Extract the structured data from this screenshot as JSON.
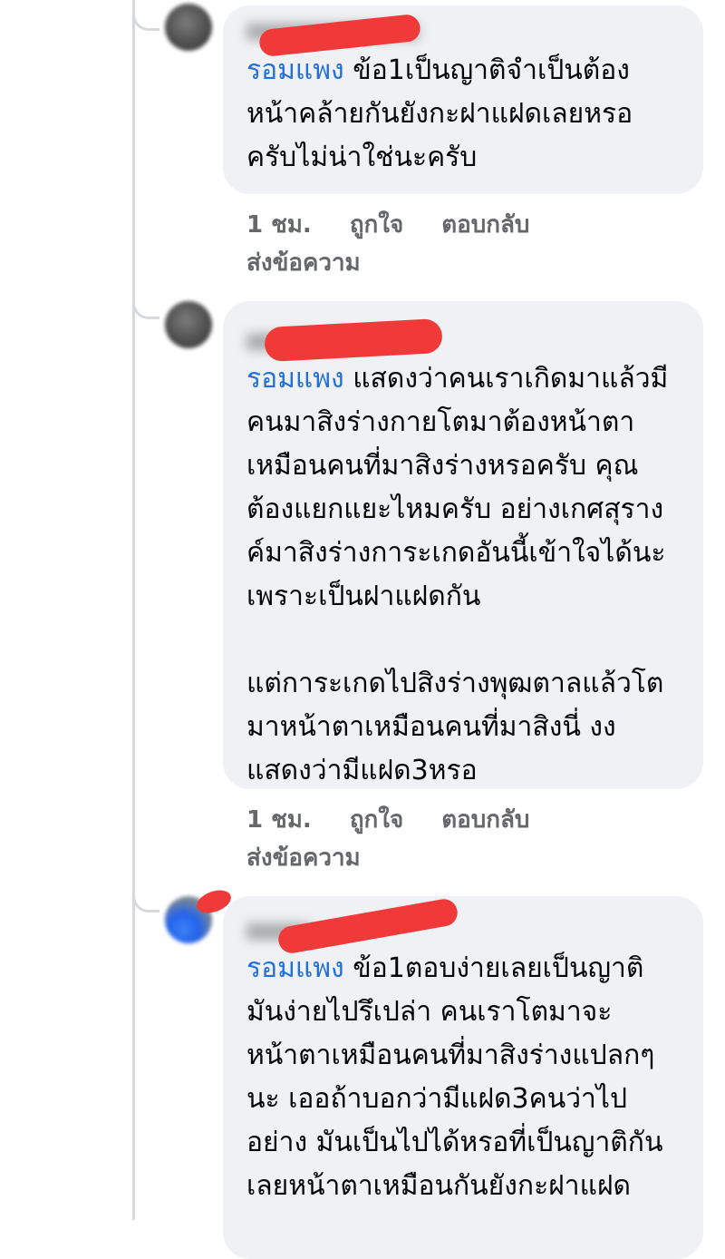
{
  "comments": [
    {
      "mention": "รอมแพง",
      "text": " ข้อ1เป็นญาติจำเป็นต้องหน้าคล้ายกันยังกะฝาแฝดเลยหรอครับไม่น่าใช่นะครับ",
      "time": "1 ชม.",
      "like": "ถูกใจ",
      "reply": "ตอบกลับ",
      "message": "ส่งข้อความ"
    },
    {
      "mention": "รอมแพง",
      "text": " แสดงว่าคนเราเกิดมาแล้วมีคนมาสิงร่างกายโตมาต้องหน้าตาเหมือนคนที่มาสิงร่างหรอครับ คุณต้องแยกแยะไหมครับ อย่างเกศสุรางค์มาสิงร่างการะเกดอันนี้เข้าใจได้นะเพราะเป็นฝาแฝดกัน\n\nแต่การะเกดไปสิงร่างพุฒตาลแล้วโตมาหน้าตาเหมือนคนที่มาสิงนี่ งงแสดงว่ามีแฝด3หรอ",
      "time": "1 ชม.",
      "like": "ถูกใจ",
      "reply": "ตอบกลับ",
      "message": "ส่งข้อความ"
    },
    {
      "mention": "รอมแพง",
      "text": " ข้อ1ตอบง่ายเลยเป็นญาติมันง่ายไปรึเปล่า คนเราโตมาจะหน้าตาเหมือนคนที่มาสิงร่างแปลกๆนะ เออถ้าบอกว่ามีแฝด3คนว่าไปอย่าง มันเป็นไปได้หรอที่เป็นญาติกัน เลยหน้าตาเหมือนกันยังกะฝาแฝด"
    }
  ]
}
